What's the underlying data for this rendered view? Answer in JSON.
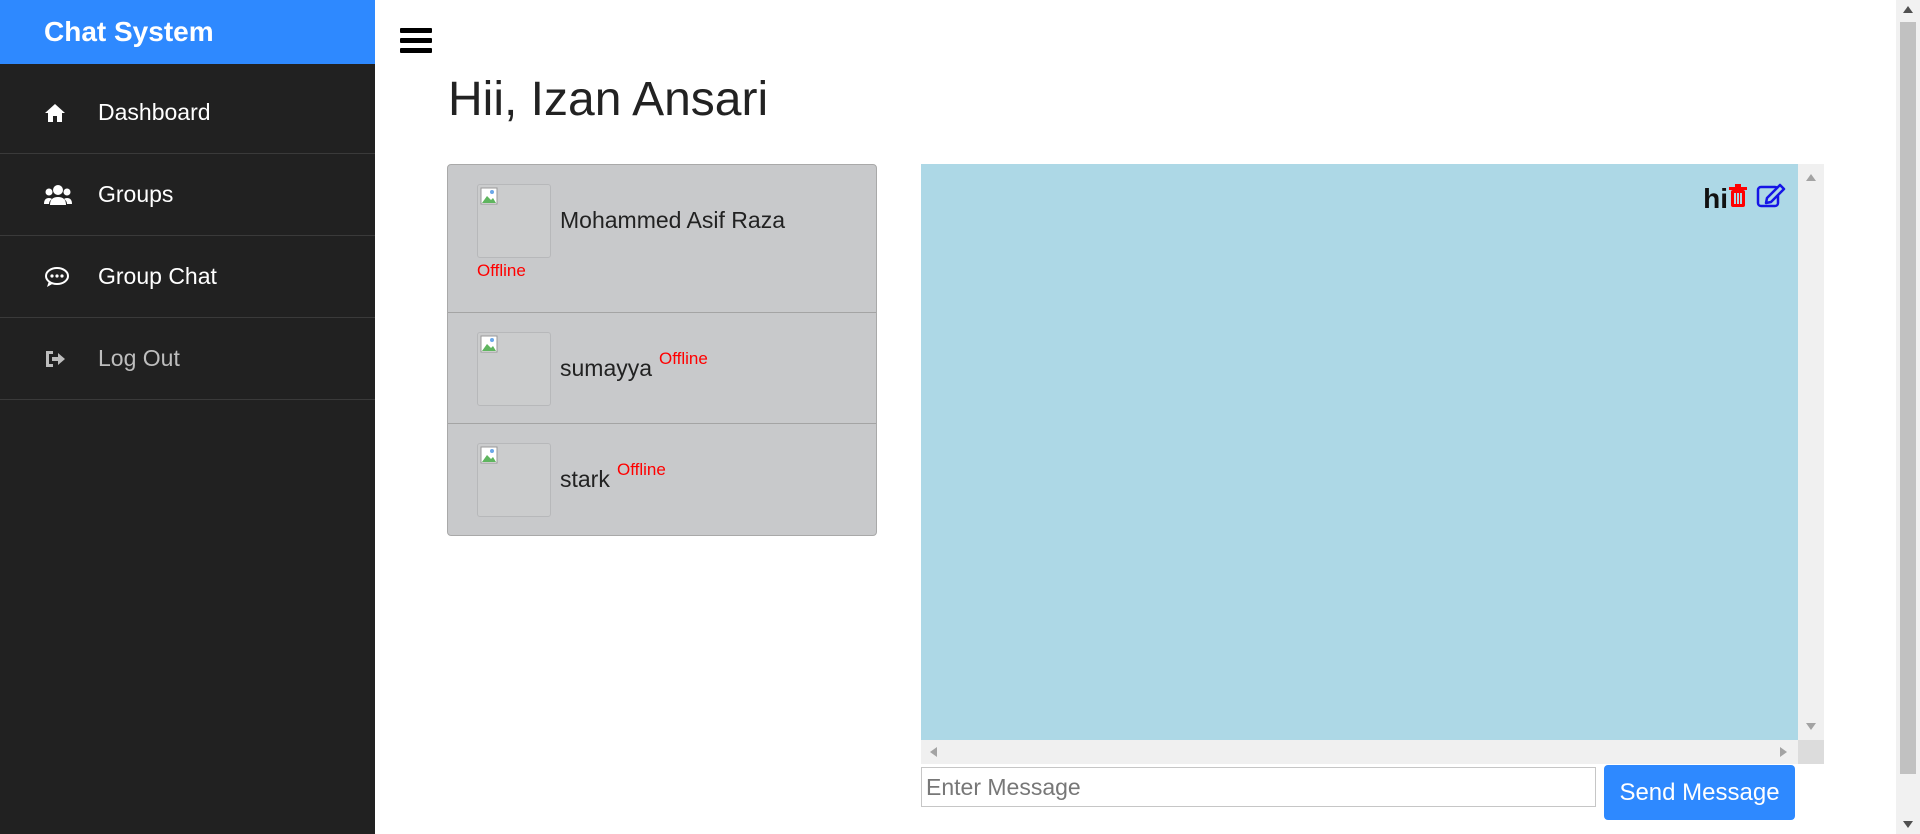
{
  "app": {
    "brand": "Chat System",
    "brand_color": "#2e89ff"
  },
  "sidebar": {
    "items": [
      {
        "label": "Dashboard",
        "icon": "home-icon"
      },
      {
        "label": "Groups",
        "icon": "users-icon"
      },
      {
        "label": "Group Chat",
        "icon": "chat-bubble-icon"
      },
      {
        "label": "Log Out",
        "icon": "sign-out-icon"
      }
    ]
  },
  "main": {
    "greeting": "Hii, Izan Ansari",
    "users": [
      {
        "name": "Mohammed Asif Raza",
        "status": "Offline"
      },
      {
        "name": "sumayya",
        "status": "Offline"
      },
      {
        "name": "stark",
        "status": "Offline"
      }
    ],
    "chat": {
      "background": "#add8e6",
      "messages": [
        {
          "text": "hi"
        }
      ]
    },
    "composer": {
      "placeholder": "Enter Message",
      "value": "",
      "send_label": "Send Message"
    }
  }
}
